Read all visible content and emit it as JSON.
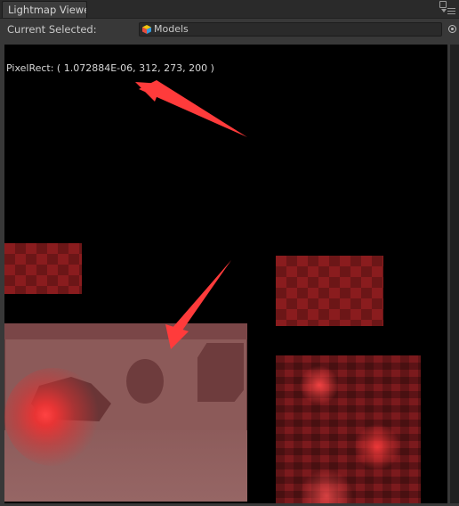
{
  "window": {
    "tab_title": "Lightmap Viewe",
    "icons": [
      "lock-icon",
      "menu-icon"
    ]
  },
  "toolbar": {
    "current_selected_label": "Current Selected:",
    "object_field": {
      "value": "Models",
      "icon": "cube-icon"
    },
    "picker_icon": "object-picker-icon"
  },
  "viewport": {
    "pixel_rect_text": "PixelRect: ( 1.072884E-06, 312, 273, 200 )",
    "background": "#000000"
  },
  "annotations": {
    "arrow_color": "#ff3b3b"
  }
}
